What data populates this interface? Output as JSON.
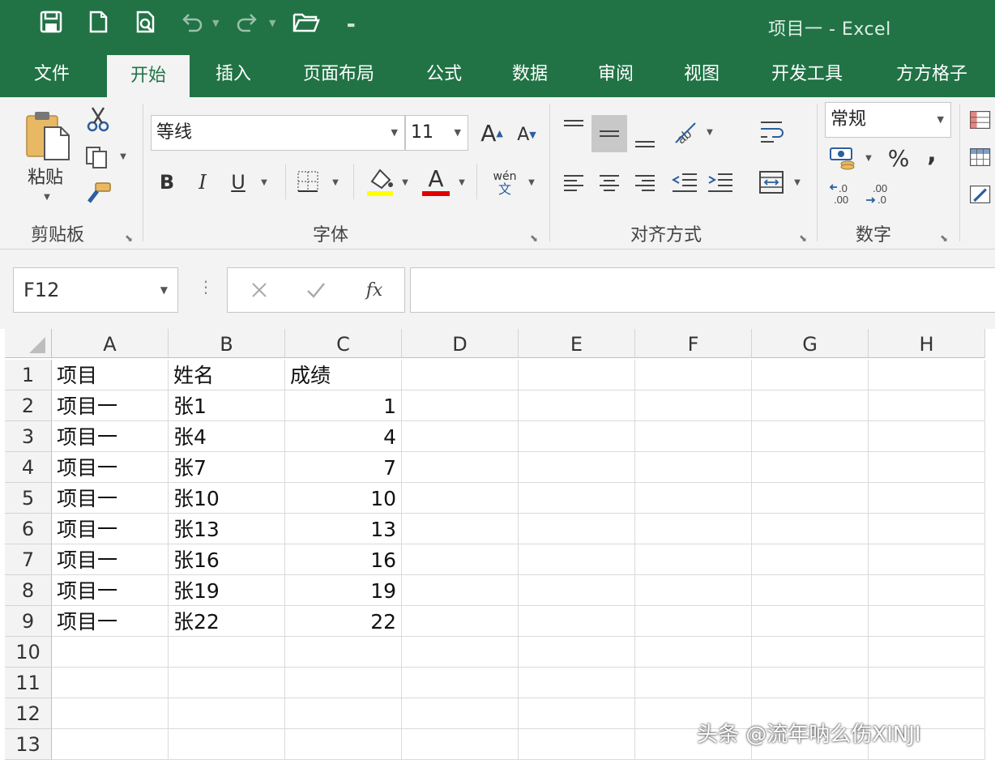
{
  "window": {
    "title": "项目一 - Excel"
  },
  "menu": {
    "tabs": [
      {
        "label": "文件"
      },
      {
        "label": "开始",
        "active": true
      },
      {
        "label": "插入"
      },
      {
        "label": "页面布局"
      },
      {
        "label": "公式"
      },
      {
        "label": "数据"
      },
      {
        "label": "审阅"
      },
      {
        "label": "视图"
      },
      {
        "label": "开发工具"
      },
      {
        "label": "方方格子"
      }
    ]
  },
  "ribbon": {
    "clipboard": {
      "paste_label": "粘贴",
      "group_label": "剪贴板"
    },
    "font": {
      "font_name": "等线",
      "font_size": "11",
      "group_label": "字体",
      "bold": "B",
      "italic": "I",
      "underline": "U",
      "phonetic_top": "wén",
      "phonetic_bottom": "文",
      "font_color": "#e00000",
      "fill_color": "#ffff00"
    },
    "alignment": {
      "group_label": "对齐方式"
    },
    "number": {
      "format": "常规",
      "group_label": "数字",
      "percent": "%",
      "comma": ","
    }
  },
  "formula_bar": {
    "name_box": "F12",
    "formula": "",
    "fx_label": "fx"
  },
  "sheet": {
    "columns": [
      "A",
      "B",
      "C",
      "D",
      "E",
      "F",
      "G",
      "H"
    ],
    "row_numbers": [
      "1",
      "2",
      "3",
      "4",
      "5",
      "6",
      "7",
      "8",
      "9",
      "10",
      "11",
      "12",
      "13"
    ],
    "rows": [
      [
        "项目",
        "姓名",
        "成绩"
      ],
      [
        "项目一",
        "张1",
        "1"
      ],
      [
        "项目一",
        "张4",
        "4"
      ],
      [
        "项目一",
        "张7",
        "7"
      ],
      [
        "项目一",
        "张10",
        "10"
      ],
      [
        "项目一",
        "张13",
        "13"
      ],
      [
        "项目一",
        "张16",
        "16"
      ],
      [
        "项目一",
        "张19",
        "19"
      ],
      [
        "项目一",
        "张22",
        "22"
      ]
    ]
  },
  "watermark": "头条 @流年呐么伤XINJI",
  "colors": {
    "accent": "#217346",
    "ribbon_bg": "#f3f3f3"
  }
}
